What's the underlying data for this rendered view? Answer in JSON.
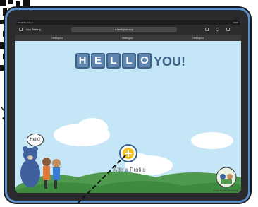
{
  "browser": {
    "status_left": "10:41 Thu May 4",
    "status_right": "100%",
    "tab_title": "App Testing",
    "url": "a.helloyou.app",
    "tabs": [
      "Helloyou",
      "Helloyou",
      "Helloyou"
    ]
  },
  "app": {
    "hello_letters": [
      "H",
      "E",
      "L",
      "L",
      "O"
    ],
    "you_word": "YOU!",
    "add_profile_label": "Add a Profile",
    "bubble_text": "Hello!",
    "sticker_text": "Kids Book Reading"
  },
  "colors": {
    "sky": "#c4e6f7",
    "hills": "#4f9a4f",
    "tile": "#5f84ae",
    "add_button": "#f3c21a",
    "frame": "#5a8fc7"
  }
}
